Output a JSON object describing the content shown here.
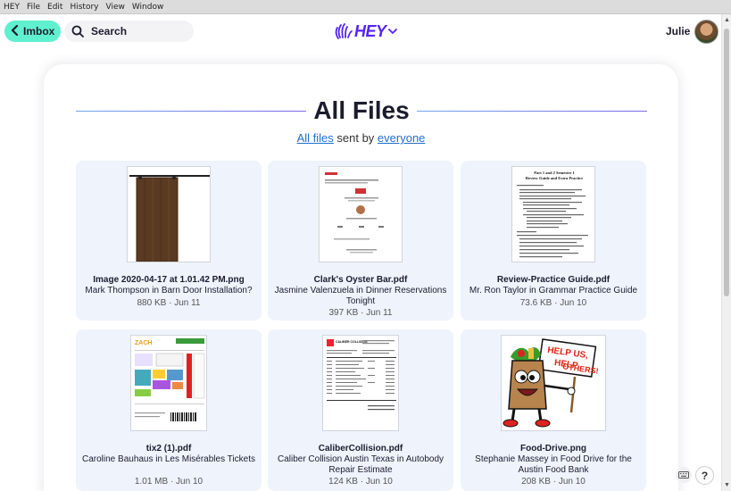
{
  "os_menu": [
    "HEY",
    "File",
    "Edit",
    "History",
    "View",
    "Window"
  ],
  "header": {
    "imbox_label": "Imbox",
    "search_label": "Search",
    "logo_text": "HEY",
    "user_name": "Julie"
  },
  "page": {
    "title": "All Files",
    "subtitle_link1": "All files",
    "subtitle_mid": " sent by ",
    "subtitle_link2": "everyone"
  },
  "files": [
    {
      "name": "Image 2020-04-17 at 1.01.42 PM.png",
      "context": "Mark Thompson in Barn Door Installation?",
      "meta": "880 KB · Jun 11"
    },
    {
      "name": "Clark's Oyster Bar.pdf",
      "context": "Jasmine Valenzuela in Dinner Reservations Tonight",
      "meta": "397 KB · Jun 11"
    },
    {
      "name": "Review-Practice Guide.pdf",
      "context": "Mr. Ron Taylor in Grammar Practice Guide",
      "meta": "73.6 KB · Jun 10"
    },
    {
      "name": "tix2 (1).pdf",
      "context": "Caroline Bauhaus in Les Misérables Tickets",
      "meta": "1.01 MB · Jun 10"
    },
    {
      "name": "CaliberCollision.pdf",
      "context": "Caliber Collision Austin Texas in Autobody Repair Estimate",
      "meta": "124 KB · Jun 10"
    },
    {
      "name": "Food-Drive.png",
      "context": "Stephanie Massey in Food Drive for the Austin Food Bank",
      "meta": "208 KB · Jun 10"
    }
  ],
  "thumb_text": {
    "review_title": "Part 1 and 2 Semester 1 Review Guide and Extra Practice",
    "zach_logo": "ZACH",
    "caliber_logo": "CALIBER COLLISION",
    "food_sign": "HELP US, HELP OTHERS!"
  },
  "colors": {
    "accent": "#5522fa",
    "imbox": "#5ff0d0",
    "card_bg": "#eef3fc",
    "link": "#1e6fd0"
  },
  "icons": {
    "back": "chevron-left-icon",
    "search": "search-icon",
    "logo_chevron": "chevron-down-icon",
    "keyboard": "keyboard-icon",
    "help": "help-icon"
  }
}
